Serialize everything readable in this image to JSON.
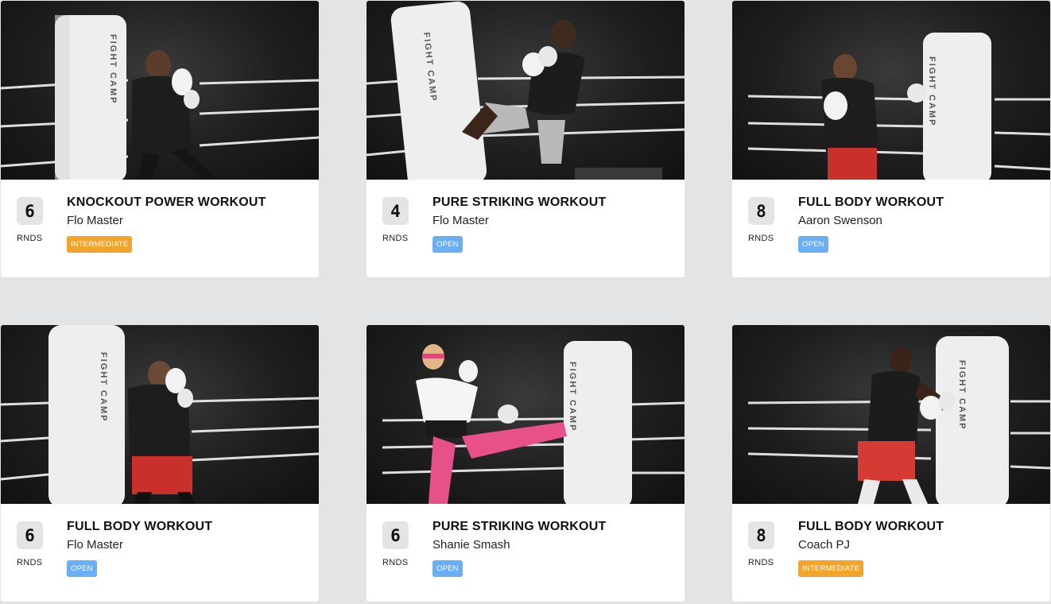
{
  "workouts": [
    {
      "rounds": "6",
      "rounds_label": "RNDS",
      "title": "KNOCKOUT POWER WORKOUT",
      "coach": "Flo Master",
      "level": "INTERMEDIATE",
      "bag_text": "FIGHT CAMP"
    },
    {
      "rounds": "4",
      "rounds_label": "RNDS",
      "title": "PURE STRIKING WORKOUT",
      "coach": "Flo Master",
      "level": "OPEN",
      "bag_text": "FIGHT CAMP"
    },
    {
      "rounds": "8",
      "rounds_label": "RNDS",
      "title": "FULL BODY WORKOUT",
      "coach": "Aaron Swenson",
      "level": "OPEN",
      "bag_text": "FIGHT CAMP"
    },
    {
      "rounds": "6",
      "rounds_label": "RNDS",
      "title": "FULL BODY WORKOUT",
      "coach": "Flo Master",
      "level": "OPEN",
      "bag_text": "FIGHT CAMP"
    },
    {
      "rounds": "6",
      "rounds_label": "RNDS",
      "title": "PURE STRIKING WORKOUT",
      "coach": "Shanie Smash",
      "level": "OPEN",
      "bag_text": "FIGHT CAMP"
    },
    {
      "rounds": "8",
      "rounds_label": "RNDS",
      "title": "FULL BODY WORKOUT",
      "coach": "Coach PJ",
      "level": "INTERMEDIATE",
      "bag_text": "FIGHT CAMP"
    }
  ],
  "colors": {
    "intermediate": "#f2a52a",
    "open": "#6aaef3",
    "background": "#e3e4e6"
  }
}
